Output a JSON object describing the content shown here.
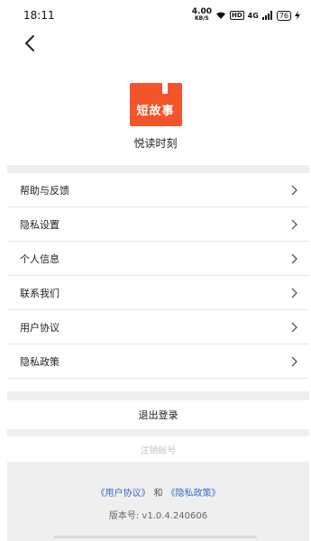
{
  "status_bar": {
    "time": "18:11",
    "net_speed_value": "4.00",
    "net_speed_unit": "KB/S",
    "hd": "HD",
    "signal": "4G",
    "battery": "76"
  },
  "app": {
    "logo_text": "短故事",
    "name": "悦读时刻",
    "brand_color": "#f4542a"
  },
  "menu": {
    "items": [
      {
        "label": "帮助与反馈"
      },
      {
        "label": "隐私设置"
      },
      {
        "label": "个人信息"
      },
      {
        "label": "联系我们"
      },
      {
        "label": "用户协议"
      },
      {
        "label": "隐私政策"
      }
    ]
  },
  "actions": {
    "logout_label": "退出登录",
    "cancel_account_label": "注销帐号"
  },
  "footer": {
    "user_agreement_link": "《用户协议》",
    "and_text": "和",
    "privacy_policy_link": "《隐私政策》",
    "version": "版本号: v1.0.4.240606",
    "link_color": "#3a6cc7"
  }
}
